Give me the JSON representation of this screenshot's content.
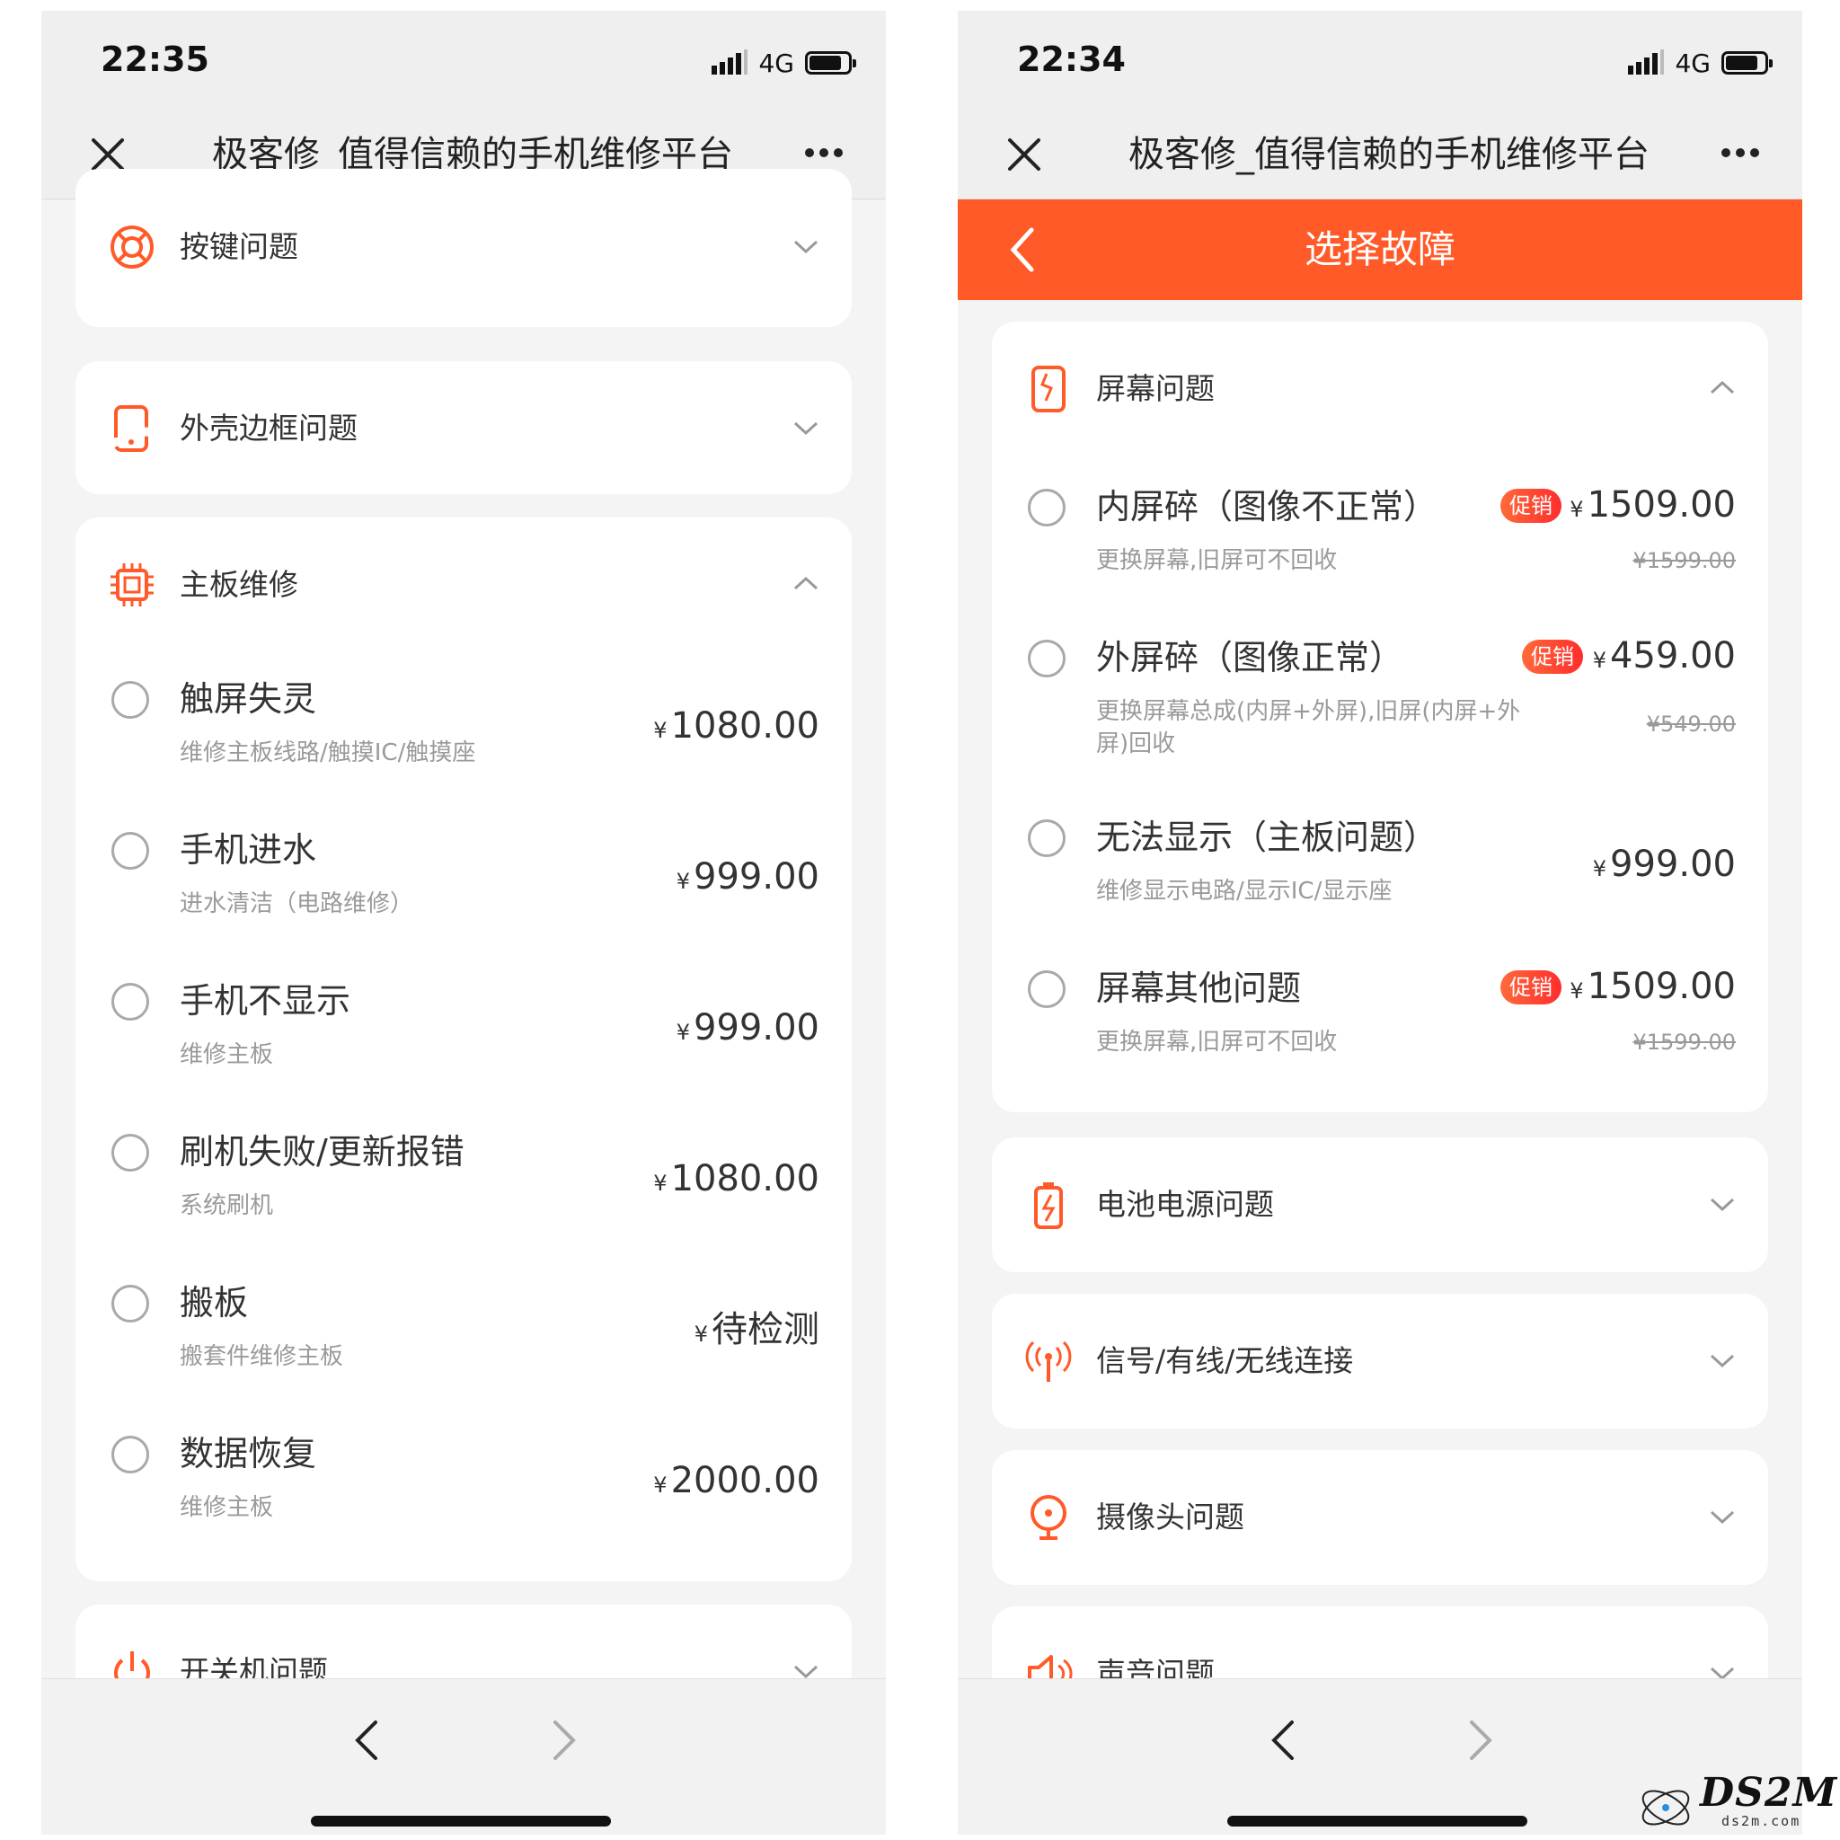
{
  "colors": {
    "accent": "#ff5a28",
    "promo": "#ff3b30",
    "card": "#ffffff",
    "bg": "#f4f4f4"
  },
  "left": {
    "status": {
      "time": "22:35",
      "network": "4G",
      "battery_level": 0.75
    },
    "title": "极客修_值得信赖的手机维修平台",
    "categories": [
      {
        "label": "按键问题",
        "icon": "lifebuoy-icon",
        "expanded": false
      },
      {
        "label": "外壳边框问题",
        "icon": "phone-frame-icon",
        "expanded": false
      },
      {
        "label": "主板维修",
        "icon": "chip-icon",
        "expanded": true
      },
      {
        "label": "开关机问题",
        "icon": "power-icon",
        "expanded": false
      }
    ],
    "items": [
      {
        "name": "触屏失灵",
        "desc": "维修主板线路/触摸IC/触摸座",
        "currency": "¥",
        "price": "1080.00"
      },
      {
        "name": "手机进水",
        "desc": "进水清洁（电路维修）",
        "currency": "¥",
        "price": "999.00"
      },
      {
        "name": "手机不显示",
        "desc": "维修主板",
        "currency": "¥",
        "price": "999.00"
      },
      {
        "name": "刷机失败/更新报错",
        "desc": "系统刷机",
        "currency": "¥",
        "price": "1080.00"
      },
      {
        "name": "搬板",
        "desc": "搬套件维修主板",
        "currency": "¥",
        "price": "待检测"
      },
      {
        "name": "数据恢复",
        "desc": "维修主板",
        "currency": "¥",
        "price": "2000.00"
      }
    ]
  },
  "right": {
    "status": {
      "time": "22:34",
      "network": "4G",
      "battery_level": 0.75
    },
    "title": "极客修_值得信赖的手机维修平台",
    "header_title": "选择故障",
    "categories": [
      {
        "label": "屏幕问题",
        "icon": "screen-icon",
        "expanded": true
      },
      {
        "label": "电池电源问题",
        "icon": "battery-icon",
        "expanded": false
      },
      {
        "label": "信号/有线/无线连接",
        "icon": "signal-icon",
        "expanded": false
      },
      {
        "label": "摄像头问题",
        "icon": "camera-icon",
        "expanded": false
      },
      {
        "label": "声音问题",
        "icon": "speaker-icon",
        "expanded": false
      }
    ],
    "items": [
      {
        "name": "内屏碎（图像不正常）",
        "desc": "更换屏幕,旧屏可不回收",
        "promo": "促销",
        "currency": "¥",
        "price": "1509.00",
        "old_price": "¥1599.00"
      },
      {
        "name": "外屏碎（图像正常）",
        "desc": "更换屏幕总成(内屏+外屏),旧屏(内屏+外屏)回收",
        "promo": "促销",
        "currency": "¥",
        "price": "459.00",
        "old_price": "¥549.00"
      },
      {
        "name": "无法显示（主板问题）",
        "desc": "维修显示电路/显示IC/显示座",
        "currency": "¥",
        "price": "999.00"
      },
      {
        "name": "屏幕其他问题",
        "desc": "更换屏幕,旧屏可不回收",
        "promo": "促销",
        "currency": "¥",
        "price": "1509.00",
        "old_price": "¥1599.00"
      }
    ]
  },
  "watermark": {
    "text": "DS2M",
    "sub": "ds2m.com"
  }
}
